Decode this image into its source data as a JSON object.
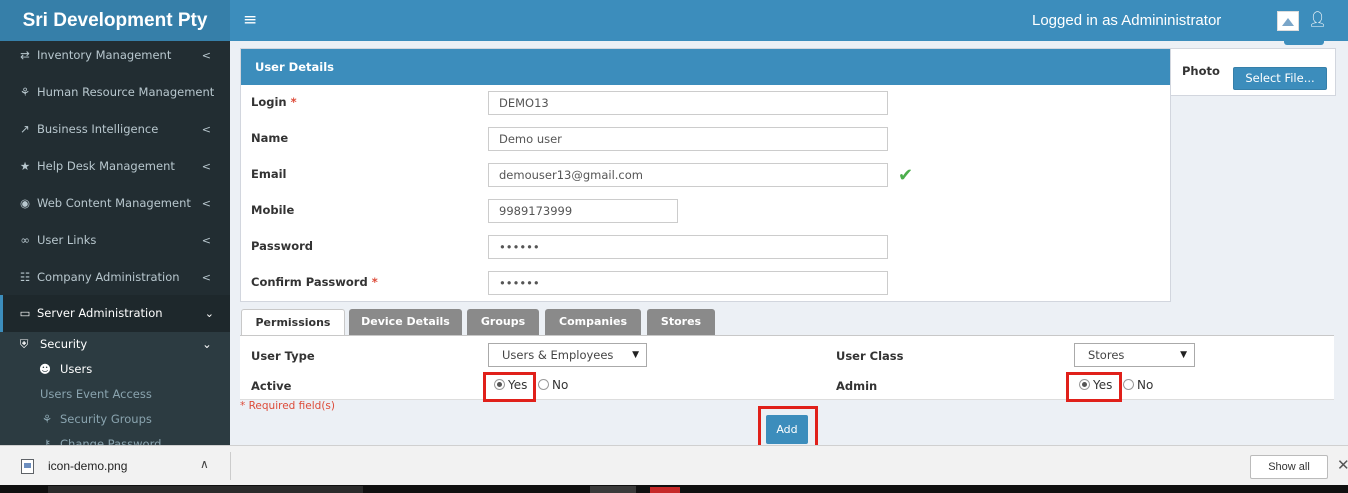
{
  "header": {
    "brand": "Sri Development Pty",
    "menu_icon": "≡",
    "logged_in_text": "Logged in as Admininistrator"
  },
  "sidebar": {
    "items": [
      {
        "icon": "⇄",
        "label": "Inventory Management",
        "arrow": "<"
      },
      {
        "icon": "⚘",
        "label": "Human Resource Management",
        "arrow": ""
      },
      {
        "icon": "↗",
        "label": "Business Intelligence",
        "arrow": "<"
      },
      {
        "icon": "★",
        "label": "Help Desk Management",
        "arrow": "<"
      },
      {
        "icon": "◉",
        "label": "Web Content Management",
        "arrow": "<"
      },
      {
        "icon": "∞",
        "label": "User Links",
        "arrow": "<"
      },
      {
        "icon": "☷",
        "label": "Company Administration",
        "arrow": "<"
      },
      {
        "icon": "▭",
        "label": "Server Administration",
        "arrow": "⌄"
      }
    ],
    "sub_items": [
      {
        "icon": "⛨",
        "label": "Security",
        "arrow": "⌄"
      },
      {
        "icon": "☻",
        "label": "Users"
      },
      {
        "icon": "",
        "label": "Users Event Access"
      },
      {
        "icon": "⚘",
        "label": "Security Groups"
      },
      {
        "icon": "⚷",
        "label": "Change Password"
      }
    ]
  },
  "user_details": {
    "title": "User Details",
    "required_mark": "*",
    "fields": {
      "login": {
        "label": "Login",
        "value": "DEMO13"
      },
      "name": {
        "label": "Name",
        "value": "Demo user"
      },
      "email": {
        "label": "Email",
        "value": "demouser13@gmail.com"
      },
      "mobile": {
        "label": "Mobile",
        "value": "9989173999"
      },
      "password": {
        "label": "Password",
        "value": "••••••"
      },
      "confirm_password": {
        "label": "Confirm Password",
        "value": "••••••"
      }
    },
    "email_valid_icon": "✔"
  },
  "photo": {
    "label": "Photo",
    "button": "Select File..."
  },
  "tabs": [
    "Permissions",
    "Device Details",
    "Groups",
    "Companies",
    "Stores"
  ],
  "permissions": {
    "user_type_label": "User Type",
    "user_type_value": "Users & Employees",
    "user_class_label": "User Class",
    "user_class_value": "Stores",
    "active_label": "Active",
    "admin_label": "Admin",
    "yes": "Yes",
    "no": "No"
  },
  "required_note": "* Required field(s)",
  "add_button": "Add",
  "downloads": {
    "file_name": "icon-demo.png",
    "chevron": "∧",
    "show_all": "Show all",
    "close": "✕"
  },
  "colors": {
    "header": "#3c8dbc",
    "brand_bg": "#367fa9",
    "sidebar": "#222d32",
    "highlight": "#e0201a",
    "required": "#dd4b39"
  }
}
